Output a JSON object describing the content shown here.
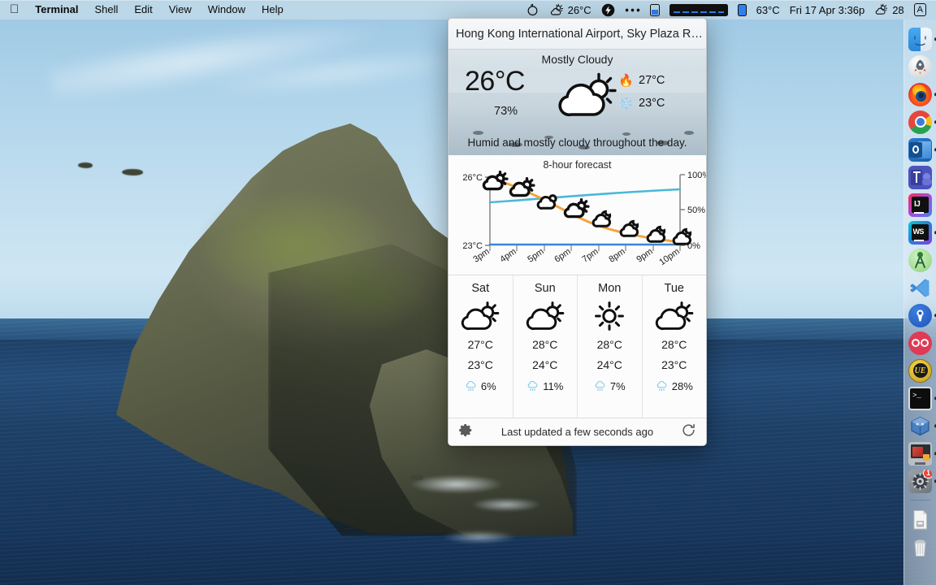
{
  "menubar": {
    "apple_icon": "apple-logo",
    "app_name": "Terminal",
    "menus": [
      "Shell",
      "Edit",
      "View",
      "Window",
      "Help"
    ],
    "status": {
      "vpn_icon": "vpn-icon",
      "weather_icon": "partly-cloudy-icon",
      "weather_temp": "26°C",
      "bolt_icon": "bolt-icon",
      "dots_icon": "control-center-dots-icon",
      "battery_icon": "battery-icon",
      "battery_wide_icon": "battery-wide-icon",
      "battery_full_icon": "battery-full-icon",
      "cpu_temp": "63°C",
      "datetime": "Fri 17 Apr 3:36p",
      "weather_icon2": "partly-cloudy-icon",
      "weather_value2": "28",
      "input_source": "A"
    }
  },
  "dock": {
    "items": [
      {
        "name": "finder",
        "label": "Finder",
        "running": true
      },
      {
        "name": "launchpad",
        "label": "Launchpad",
        "running": false
      },
      {
        "name": "firefox",
        "label": "Firefox",
        "running": true
      },
      {
        "name": "chrome",
        "label": "Google Chrome",
        "running": true
      },
      {
        "name": "outlook",
        "label": "Microsoft Outlook",
        "running": true
      },
      {
        "name": "teams",
        "label": "Microsoft Teams",
        "running": false
      },
      {
        "name": "intellij-idea",
        "label": "IntelliJ IDEA",
        "running": false
      },
      {
        "name": "webstorm",
        "label": "WebStorm",
        "running": true
      },
      {
        "name": "android-studio",
        "label": "Android Studio",
        "running": false
      },
      {
        "name": "vscode",
        "label": "Visual Studio Code",
        "running": false
      },
      {
        "name": "postman",
        "label": "Postman",
        "running": true
      },
      {
        "name": "sourcetree",
        "label": "Sourcetree",
        "running": false
      },
      {
        "name": "ultraedit",
        "label": "UltraEdit",
        "running": false
      },
      {
        "name": "terminal",
        "label": "Terminal",
        "running": true
      },
      {
        "name": "virtualbox",
        "label": "VirtualBox",
        "running": true
      },
      {
        "name": "screenshot-tool",
        "label": "Snagit",
        "running": true
      },
      {
        "name": "system-preferences",
        "label": "System Preferences",
        "running": true,
        "badge": "1"
      }
    ],
    "downloads_label": "Downloads",
    "trash_label": "Trash"
  },
  "weather": {
    "location": "Hong Kong International Airport, Sky Plaza R…",
    "summary": "Mostly Cloudy",
    "current_temp": "26°C",
    "humidity": "73%",
    "high_icon": "fire-emoji",
    "high_temp": "27°C",
    "low_icon": "snowflake-emoji",
    "low_temp": "23°C",
    "description": "Humid and mostly cloudy throughout the day.",
    "current_icon": "partly-cloudy-day-icon",
    "chart_title": "8-hour forecast",
    "days": [
      {
        "name": "Sat",
        "icon": "partly-cloudy-day-icon",
        "high": "27°C",
        "low": "23°C",
        "rain_icon": "rain-icon",
        "rain": "6%"
      },
      {
        "name": "Sun",
        "icon": "partly-cloudy-day-icon",
        "high": "28°C",
        "low": "24°C",
        "rain_icon": "rain-icon",
        "rain": "11%"
      },
      {
        "name": "Mon",
        "icon": "sunny-icon",
        "high": "28°C",
        "low": "24°C",
        "rain_icon": "rain-icon",
        "rain": "7%"
      },
      {
        "name": "Tue",
        "icon": "partly-cloudy-day-icon",
        "high": "28°C",
        "low": "23°C",
        "rain_icon": "rain-icon",
        "rain": "28%"
      }
    ],
    "footer": {
      "settings_icon": "gear-icon",
      "status": "Last updated a few seconds ago",
      "refresh_icon": "refresh-icon"
    }
  },
  "chart_data": {
    "type": "line",
    "title": "8-hour forecast",
    "x": [
      "3pm",
      "4pm",
      "5pm",
      "6pm",
      "7pm",
      "8pm",
      "9pm",
      "10pm"
    ],
    "xlabel": "",
    "ylabel": "",
    "ylim": [
      23,
      26
    ],
    "y_ticks": [
      "23°C",
      "26°C"
    ],
    "y2lim": [
      0,
      100
    ],
    "y2_ticks": [
      "0%",
      "50%",
      "100%"
    ],
    "grid": false,
    "legend": "none",
    "series": [
      {
        "name": "Temperature",
        "axis": "left",
        "color": "#f5a33c",
        "units": "°C",
        "values": [
          26.0,
          25.6,
          24.9,
          24.5,
          24.0,
          23.6,
          23.4,
          23.2
        ],
        "point_icons": [
          "partly-cloudy-day-icon",
          "partly-cloudy-day-icon",
          "partly-cloudy-day-icon",
          "partly-cloudy-day-icon",
          "partly-cloudy-night-icon",
          "partly-cloudy-night-icon",
          "partly-cloudy-night-icon",
          "partly-cloudy-night-icon"
        ]
      },
      {
        "name": "Humidity",
        "axis": "right",
        "color": "#49b8d8",
        "units": "%",
        "values": [
          73,
          74,
          75,
          77,
          78,
          80,
          81,
          83
        ]
      },
      {
        "name": "Precipitation",
        "axis": "right",
        "color": "#3b86d8",
        "units": "%",
        "values": [
          0,
          0,
          0,
          0,
          0,
          0,
          0,
          0
        ]
      }
    ]
  }
}
